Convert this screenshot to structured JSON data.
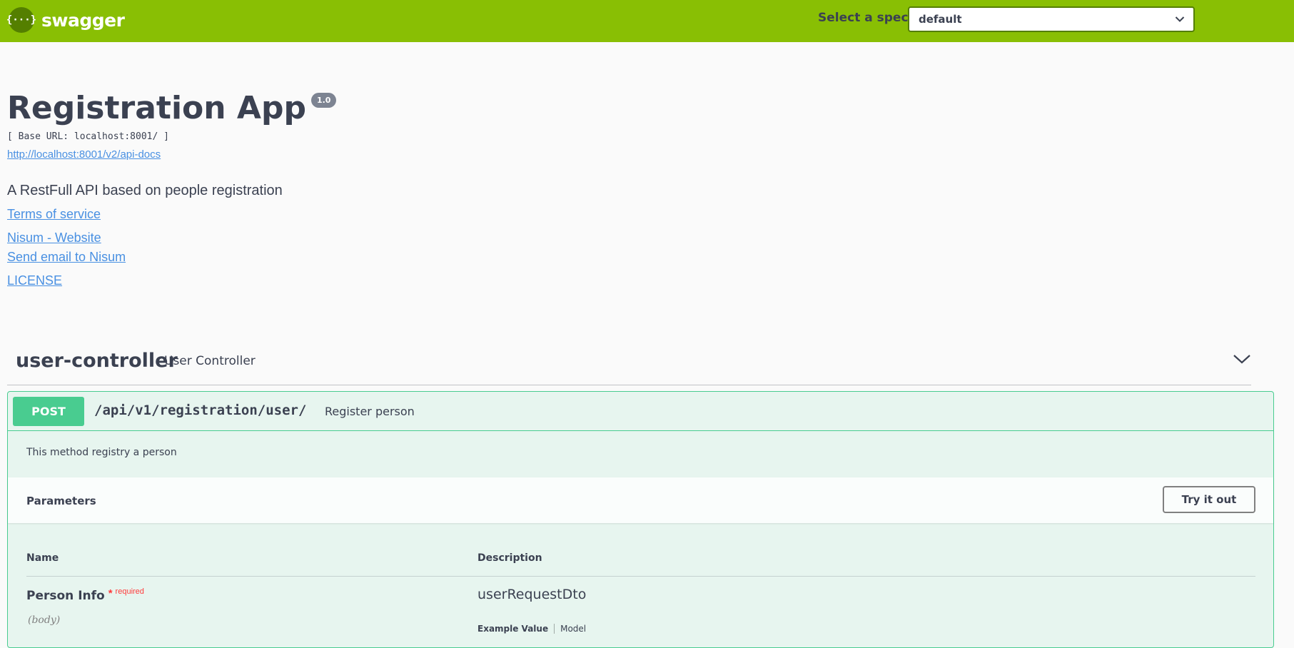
{
  "topbar": {
    "logo_glyph": "{···}",
    "logo_text": "swagger",
    "spec_label": "Select a spec",
    "spec_selected": "default",
    "bg_color": "#89bf04"
  },
  "info": {
    "title": "Registration App",
    "version": "1.0",
    "base_url": "[ Base URL: localhost:8001/ ]",
    "api_docs_link": "http://localhost:8001/v2/api-docs",
    "description": "A RestFull API based on people registration",
    "links": {
      "terms": "Terms of service",
      "website": "Nisum - Website",
      "email": "Send email to Nisum",
      "license": "LICENSE"
    }
  },
  "tag": {
    "name": "user-controller",
    "description": "User Controller",
    "chevron_icon": "chevron-down-icon"
  },
  "operation": {
    "method": "POST",
    "path": "/api/v1/registration/user/",
    "summary": "Register person",
    "description": "This method registry a person",
    "method_color": "#49cc90",
    "parameters": {
      "title": "Parameters",
      "try_button": "Try it out",
      "col_name": "Name",
      "col_description": "Description",
      "rows": [
        {
          "name": "Person Info",
          "required_star": "*",
          "required_label": "required",
          "in": "(body)",
          "type": "userRequestDto",
          "tab_example": "Example Value",
          "tab_model": "Model"
        }
      ]
    }
  }
}
